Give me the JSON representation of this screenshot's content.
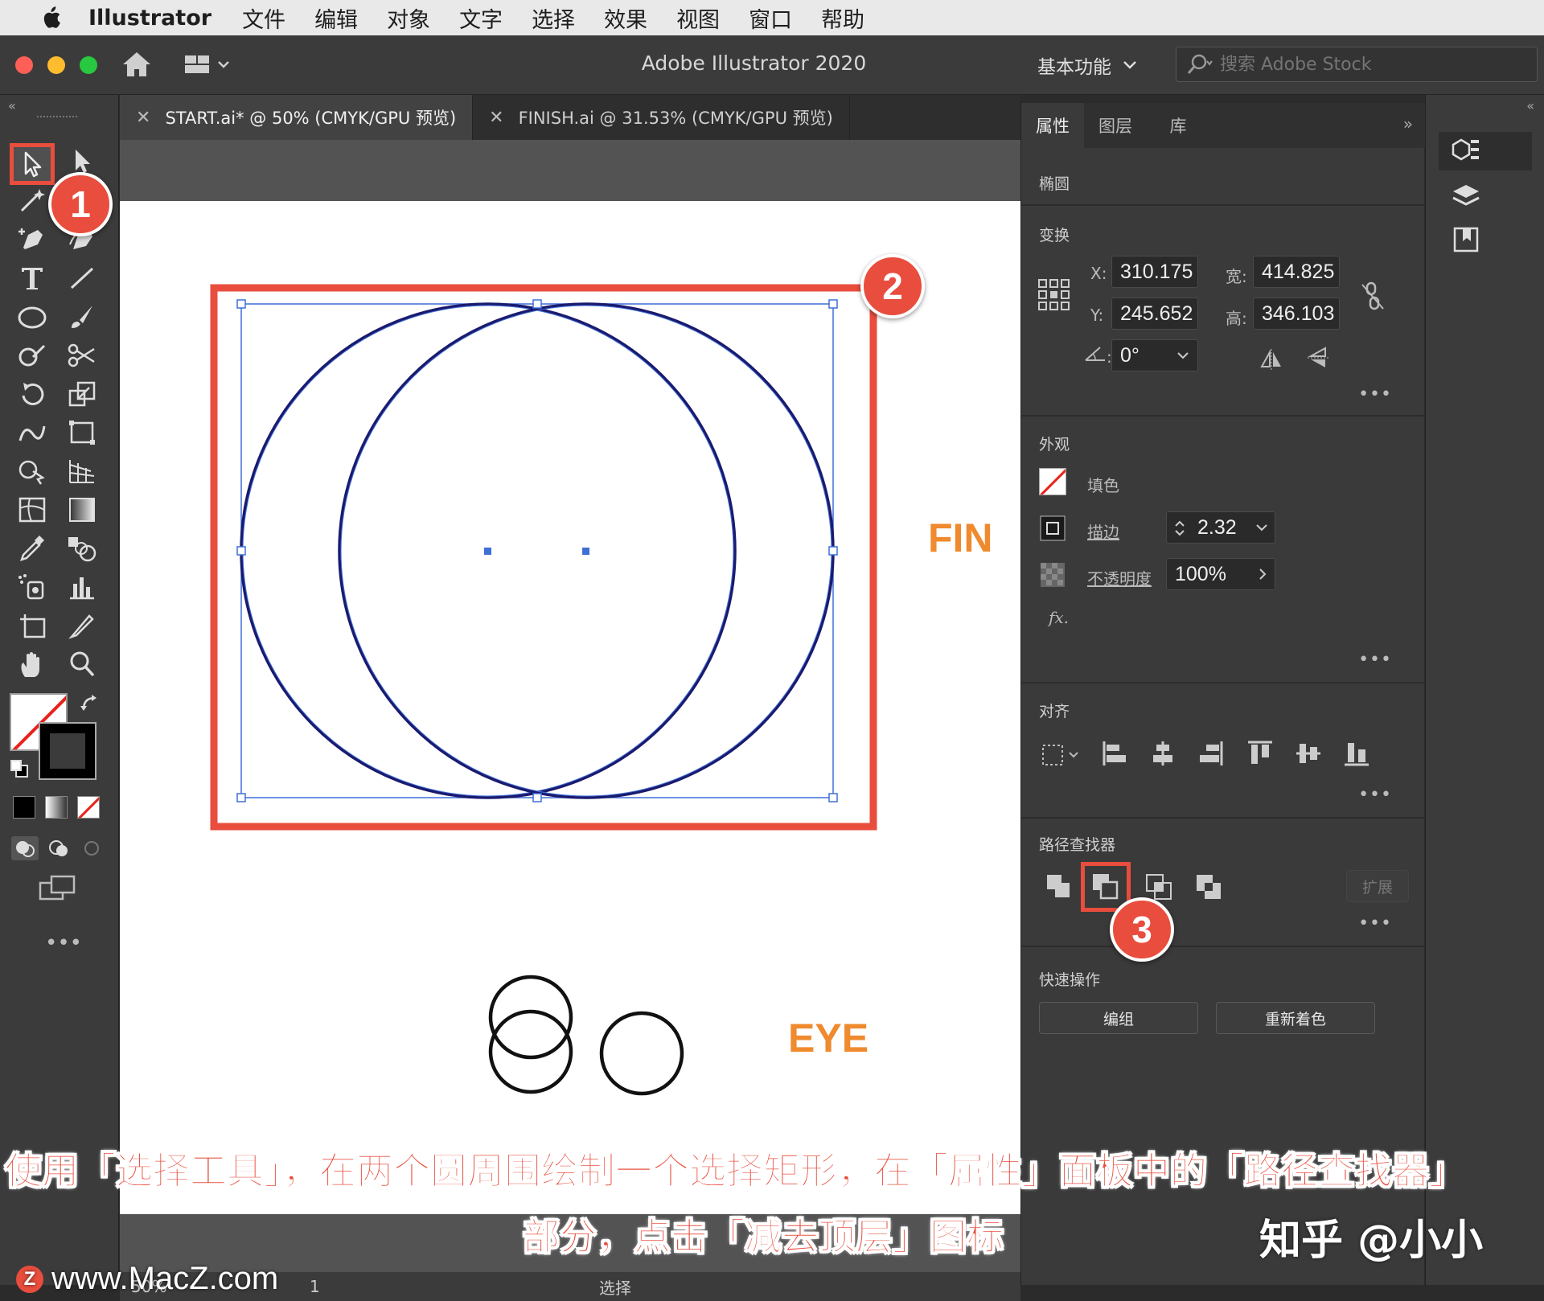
{
  "menubar": {
    "app_name": "Illustrator",
    "items": [
      "文件",
      "编辑",
      "对象",
      "文字",
      "选择",
      "效果",
      "视图",
      "窗口",
      "帮助"
    ]
  },
  "titlebar": {
    "title": "Adobe Illustrator 2020",
    "workspace": "基本功能",
    "search_placeholder": "搜索 Adobe Stock"
  },
  "tabs": [
    {
      "label": "START.ai* @ 50% (CMYK/GPU 预览)",
      "active": true
    },
    {
      "label": "FINISH.ai @ 31.53% (CMYK/GPU 预览)",
      "active": false
    }
  ],
  "artboard": {
    "label_fin": "FIN",
    "label_eye": "EYE"
  },
  "badges": {
    "one": "1",
    "two": "2",
    "three": "3"
  },
  "panel": {
    "tabs": [
      "属性",
      "图层",
      "库"
    ],
    "object_type": "椭圆",
    "transform": {
      "title": "变换",
      "x_label": "X:",
      "x": "310.175",
      "y_label": "Y:",
      "y": "245.652",
      "w_label": "宽:",
      "w": "414.825",
      "h_label": "高:",
      "h": "346.103",
      "angle": "0°"
    },
    "appearance": {
      "title": "外观",
      "fill_label": "填色",
      "stroke_label": "描边",
      "stroke_value": "2.32",
      "opacity_label": "不透明度",
      "opacity_value": "100%",
      "fx": "fx."
    },
    "align": {
      "title": "对齐"
    },
    "pathfinder": {
      "title": "路径查找器",
      "expand": "扩展"
    },
    "quick_actions": {
      "title": "快速操作",
      "group": "编组",
      "recolor": "重新着色"
    }
  },
  "statusbar": {
    "zoom": "50%",
    "page": "1",
    "tool": "选择"
  },
  "captions": {
    "line1": "使用「选择工具」，在两个圆周围绘制一个选择矩形，在「属性」面板中的「路径查找器」",
    "line2": "部分，点击「减去顶层」图标",
    "watermark_right": "知乎 @小小",
    "watermark_left": "www.MacZ.com"
  },
  "colors": {
    "accent_red": "#e84d3d",
    "label_orange": "#ef8a2e",
    "selection_blue": "#3f6fd8"
  }
}
